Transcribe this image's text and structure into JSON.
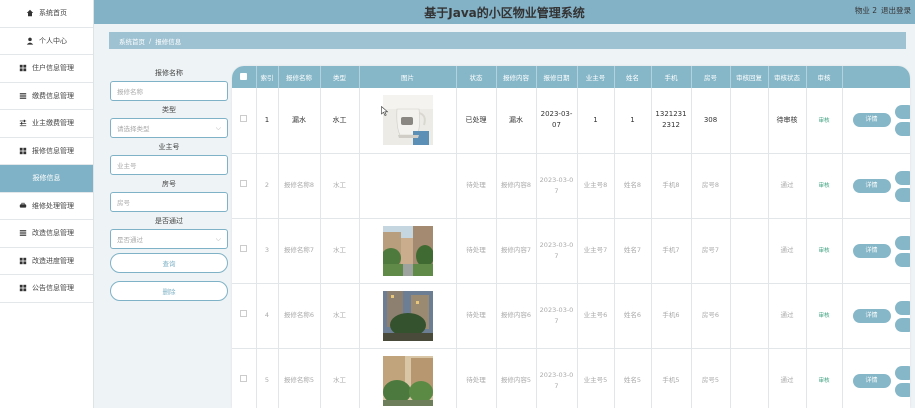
{
  "sidebar": {
    "items": [
      {
        "label": "系统首页",
        "icon": "home-icon",
        "active": false
      },
      {
        "label": "个人中心",
        "icon": "user-icon",
        "active": false
      },
      {
        "label": "住户信息管理",
        "icon": "grid-icon",
        "active": false
      },
      {
        "label": "缴费信息管理",
        "icon": "list-icon",
        "active": false
      },
      {
        "label": "业主缴费管理",
        "icon": "sliders-icon",
        "active": false
      },
      {
        "label": "报修信息管理",
        "icon": "grid-icon",
        "active": false
      },
      {
        "label": "报修信息",
        "icon": "",
        "active": true
      },
      {
        "label": "维修处理管理",
        "icon": "tools-icon",
        "active": false
      },
      {
        "label": "改造信息管理",
        "icon": "list-icon",
        "active": false
      },
      {
        "label": "改造进度管理",
        "icon": "grid-icon",
        "active": false
      },
      {
        "label": "公告信息管理",
        "icon": "grid-icon",
        "active": false
      }
    ]
  },
  "header": {
    "title": "基于Java的小区物业管理系统",
    "user": "物业 2",
    "logout": "退出登录"
  },
  "breadcrumb": {
    "home": "系统首页",
    "sep": "/",
    "current": "报修信息"
  },
  "search": {
    "name_label": "报修名称",
    "name_placeholder": "报修名称",
    "type_label": "类型",
    "type_placeholder": "请选择类型",
    "owner_label": "业主号",
    "owner_placeholder": "业主号",
    "room_label": "房号",
    "room_placeholder": "房号",
    "passed_label": "是否通过",
    "passed_placeholder": "是否通过",
    "query_button": "查询",
    "delete_button": "删除"
  },
  "table": {
    "columns": [
      "索引",
      "报修名称",
      "类型",
      "图片",
      "状态",
      "报修内容",
      "报修日期",
      "业主号",
      "姓名",
      "手机",
      "房号",
      "审核回复",
      "审核状态",
      "审核"
    ],
    "detail_label": "详情",
    "audit_link": "审核",
    "rows": [
      {
        "index": "1",
        "name": "漏水",
        "type": "水工",
        "photo": "kettle",
        "status": "已处理",
        "content": "漏水",
        "date": "2023-03-07",
        "owner": "1",
        "person": "1",
        "phone": "13212312312",
        "room": "308",
        "reply": "",
        "audit_status": "待审核"
      },
      {
        "index": "2",
        "name": "报修名称8",
        "type": "水工",
        "photo": "",
        "status": "待处理",
        "content": "报修内容8",
        "date": "2023-03-07",
        "owner": "业主号8",
        "person": "姓名8",
        "phone": "手机8",
        "room": "房号8",
        "reply": "",
        "audit_status": "通过"
      },
      {
        "index": "3",
        "name": "报修名称7",
        "type": "水工",
        "photo": "garden",
        "status": "待处理",
        "content": "报修内容7",
        "date": "2023-03-07",
        "owner": "业主号7",
        "person": "姓名7",
        "phone": "手机7",
        "room": "房号7",
        "reply": "",
        "audit_status": "通过"
      },
      {
        "index": "4",
        "name": "报修名称6",
        "type": "水工",
        "photo": "night",
        "status": "待处理",
        "content": "报修内容6",
        "date": "2023-03-07",
        "owner": "业主号6",
        "person": "姓名6",
        "phone": "手机6",
        "room": "房号6",
        "reply": "",
        "audit_status": "通过"
      },
      {
        "index": "5",
        "name": "报修名称5",
        "type": "水工",
        "photo": "court",
        "status": "待处理",
        "content": "报修内容5",
        "date": "2023-03-07",
        "owner": "业主号5",
        "person": "姓名5",
        "phone": "手机5",
        "room": "房号5",
        "reply": "",
        "audit_status": "通过"
      }
    ]
  },
  "colors": {
    "accent": "#86b7c8",
    "sidebar_active": "#7fb2c6",
    "audit_link": "#3aa17e"
  }
}
